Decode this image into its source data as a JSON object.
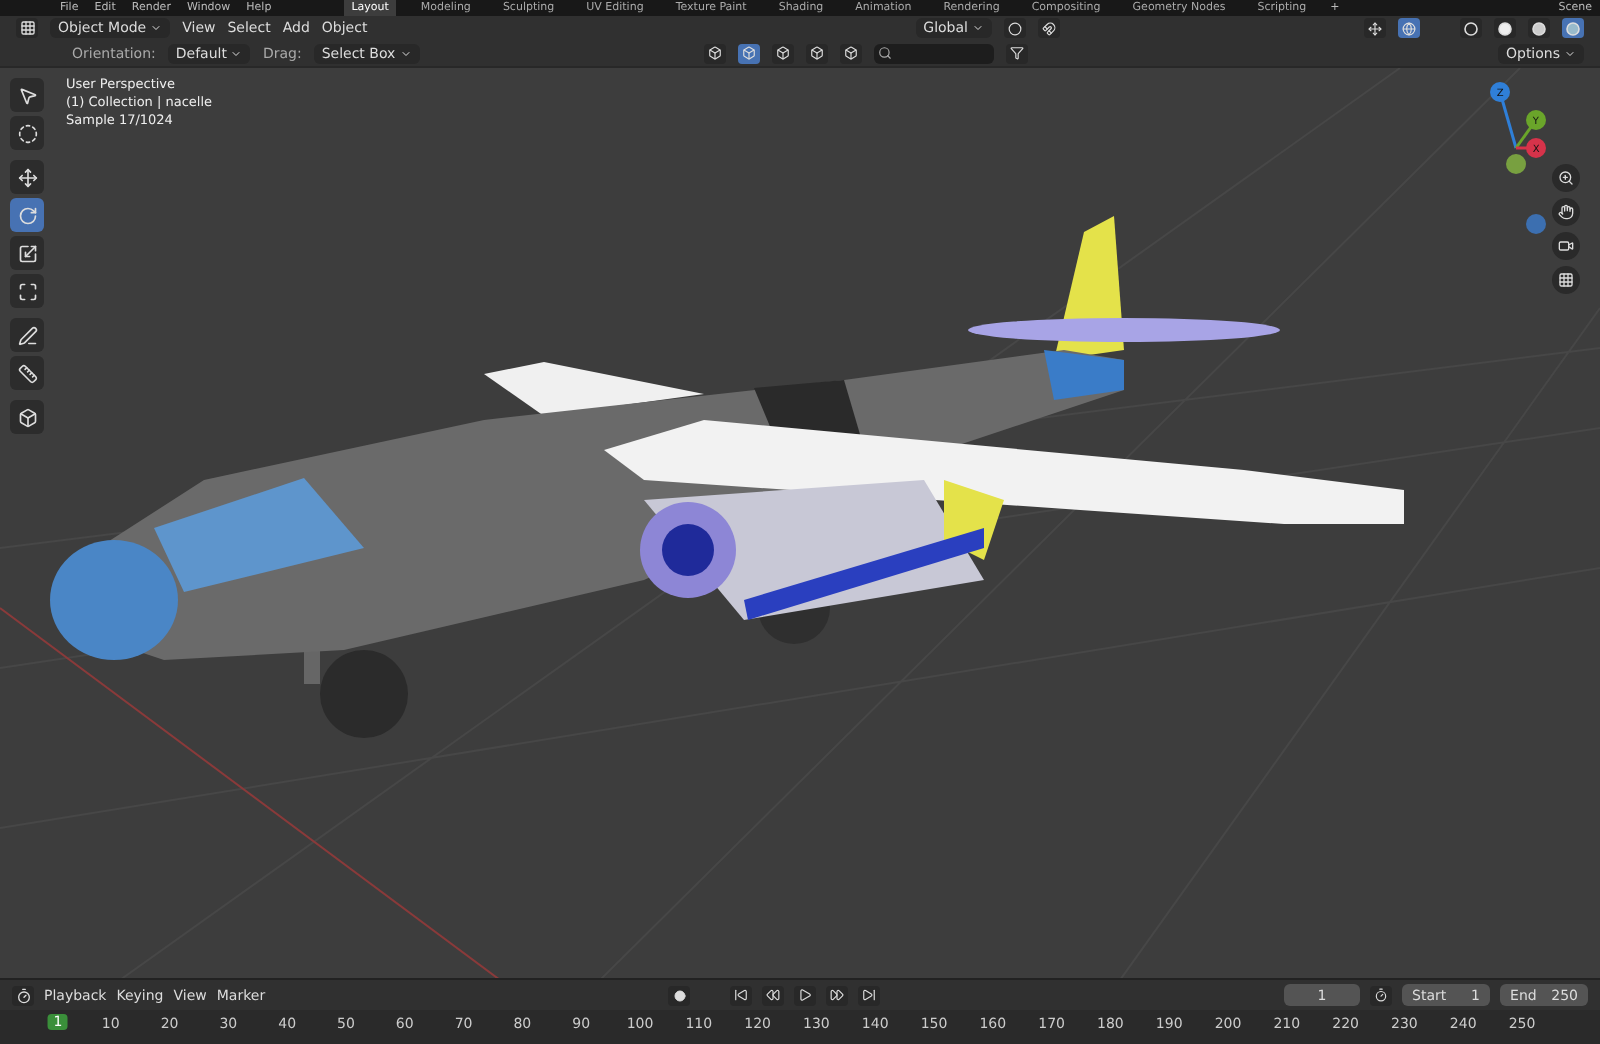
{
  "top_menu": [
    "File",
    "Edit",
    "Render",
    "Window",
    "Help"
  ],
  "workspaces": [
    {
      "label": "Layout",
      "selected": true
    },
    {
      "label": "Modeling",
      "selected": false
    },
    {
      "label": "Sculpting",
      "selected": false
    },
    {
      "label": "UV Editing",
      "selected": false
    },
    {
      "label": "Texture Paint",
      "selected": false
    },
    {
      "label": "Shading",
      "selected": false
    },
    {
      "label": "Animation",
      "selected": false
    },
    {
      "label": "Rendering",
      "selected": false
    },
    {
      "label": "Compositing",
      "selected": false
    },
    {
      "label": "Geometry Nodes",
      "selected": false
    },
    {
      "label": "Scripting",
      "selected": false
    }
  ],
  "add_workspace": "+",
  "scene": "Scene",
  "header": {
    "mode": "Object Mode",
    "menus": [
      "View",
      "Select",
      "Add",
      "Object"
    ],
    "transform_orientation": "Global"
  },
  "shading": [
    {
      "kind": "wireframe",
      "selected": false
    },
    {
      "kind": "solid",
      "selected": false
    },
    {
      "kind": "material",
      "selected": false
    },
    {
      "kind": "rendered",
      "selected": true
    }
  ],
  "tool_settings": {
    "orientation_label": "Orientation:",
    "orientation": "Default",
    "drag_label": "Drag:",
    "drag": "Select Box",
    "options": "Options"
  },
  "select_modes": [
    {
      "selected": false
    },
    {
      "selected": true
    },
    {
      "selected": false
    },
    {
      "selected": false
    },
    {
      "selected": false
    }
  ],
  "tools": [
    {
      "kind": "select",
      "selected": false
    },
    {
      "kind": "cursor",
      "selected": false
    },
    {
      "kind": "move",
      "selected": false
    },
    {
      "kind": "rotate",
      "selected": true
    },
    {
      "kind": "scale",
      "selected": false
    },
    {
      "kind": "transform",
      "selected": false
    },
    {
      "kind": "annotate",
      "selected": false
    },
    {
      "kind": "measure",
      "selected": false
    },
    {
      "kind": "add-cube",
      "selected": false
    }
  ],
  "overlay": [
    "User Perspective",
    "(1) Collection | nacelle",
    "Sample 17/1024"
  ],
  "gizmo_axes": [
    "Z",
    "Y",
    "X"
  ],
  "timeline": {
    "menus": [
      "Playback",
      "Keying",
      "View",
      "Marker"
    ],
    "current_frame": "1",
    "start_label": "Start",
    "start": "1",
    "end_label": "End",
    "end": "250",
    "ticks": [
      "1",
      "10",
      "20",
      "30",
      "40",
      "50",
      "60",
      "70",
      "80",
      "90",
      "100",
      "110",
      "120",
      "130",
      "140",
      "150",
      "160",
      "170",
      "180",
      "190",
      "200",
      "210",
      "220",
      "230",
      "240",
      "250"
    ]
  }
}
